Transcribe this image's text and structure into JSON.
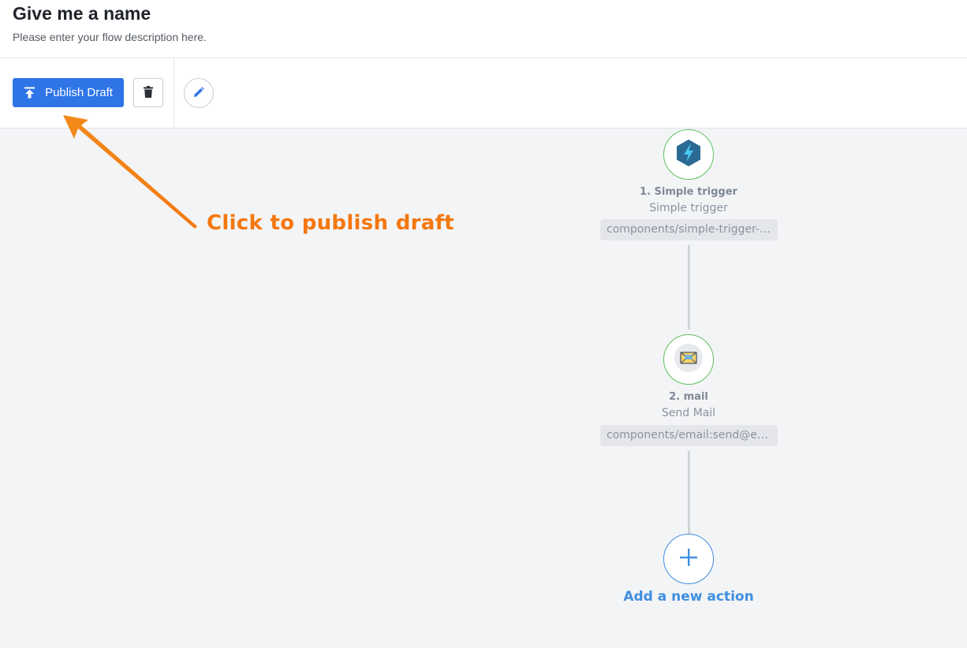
{
  "header": {
    "title": "Give me a name",
    "description": "Please enter your flow description here."
  },
  "toolbar": {
    "publish_label": "Publish Draft",
    "publish_icon": "upload-arrow-icon",
    "delete_icon": "trash-icon",
    "edit_icon": "pencil-icon"
  },
  "annotation": {
    "text": "Click to publish draft",
    "color": "#f5770d"
  },
  "flow": {
    "steps": [
      {
        "title": "1. Simple trigger",
        "subtitle": "Simple trigger",
        "component": "components/simple-trigger-component",
        "icon": "lightning-hexagon-icon"
      },
      {
        "title": "2. mail",
        "subtitle": "Send Mail",
        "component": "components/email:send@email",
        "icon": "envelope-icon"
      }
    ],
    "add_action_label": "Add a new action"
  },
  "colors": {
    "primary": "#2f75e8",
    "node_border": "#5cc15e",
    "add_accent": "#3f8ee0",
    "canvas_bg": "#f3f4f6"
  }
}
